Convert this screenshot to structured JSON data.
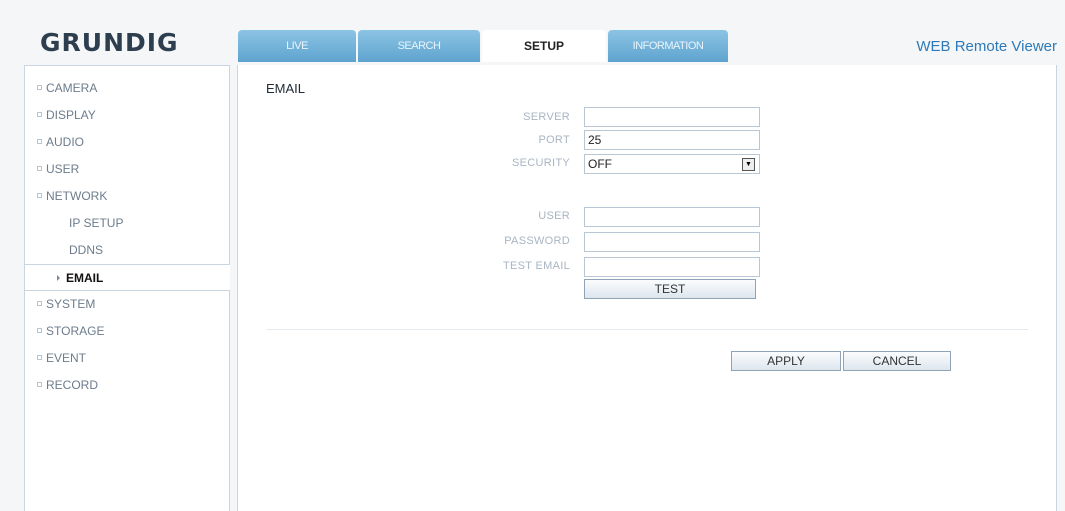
{
  "brand": "GRUNDIG",
  "app_title": "WEB Remote Viewer",
  "tabs": [
    {
      "label": "LIVE"
    },
    {
      "label": "SEARCH"
    },
    {
      "label": "SETUP"
    },
    {
      "label": "INFORMATION"
    }
  ],
  "active_tab": "SETUP",
  "sidebar": {
    "items": [
      {
        "label": "CAMERA"
      },
      {
        "label": "DISPLAY"
      },
      {
        "label": "AUDIO"
      },
      {
        "label": "USER"
      },
      {
        "label": "NETWORK"
      },
      {
        "label": "IP SETUP"
      },
      {
        "label": "DDNS"
      },
      {
        "label": "EMAIL"
      },
      {
        "label": "SYSTEM"
      },
      {
        "label": "STORAGE"
      },
      {
        "label": "EVENT"
      },
      {
        "label": "RECORD"
      }
    ],
    "active": "EMAIL"
  },
  "main": {
    "section_title": "EMAIL",
    "fields": {
      "server": {
        "label": "SERVER",
        "value": ""
      },
      "port": {
        "label": "PORT",
        "value": "25"
      },
      "security": {
        "label": "SECURITY",
        "value": "OFF"
      },
      "user": {
        "label": "USER",
        "value": ""
      },
      "password": {
        "label": "PASSWORD",
        "value": ""
      },
      "test_email": {
        "label": "TEST EMAIL",
        "value": ""
      }
    },
    "test_button": "TEST",
    "apply_button": "APPLY",
    "cancel_button": "CANCEL"
  },
  "icons": {
    "bullet": "square-bullet-icon",
    "arrow": "right-arrow-icon",
    "dropdown": "chevron-down-icon"
  },
  "colors": {
    "tab_bg": "#6aaed6",
    "tab_active_bg": "#ffffff",
    "title": "#2e7ab8",
    "logo": "#2d3e4f"
  }
}
